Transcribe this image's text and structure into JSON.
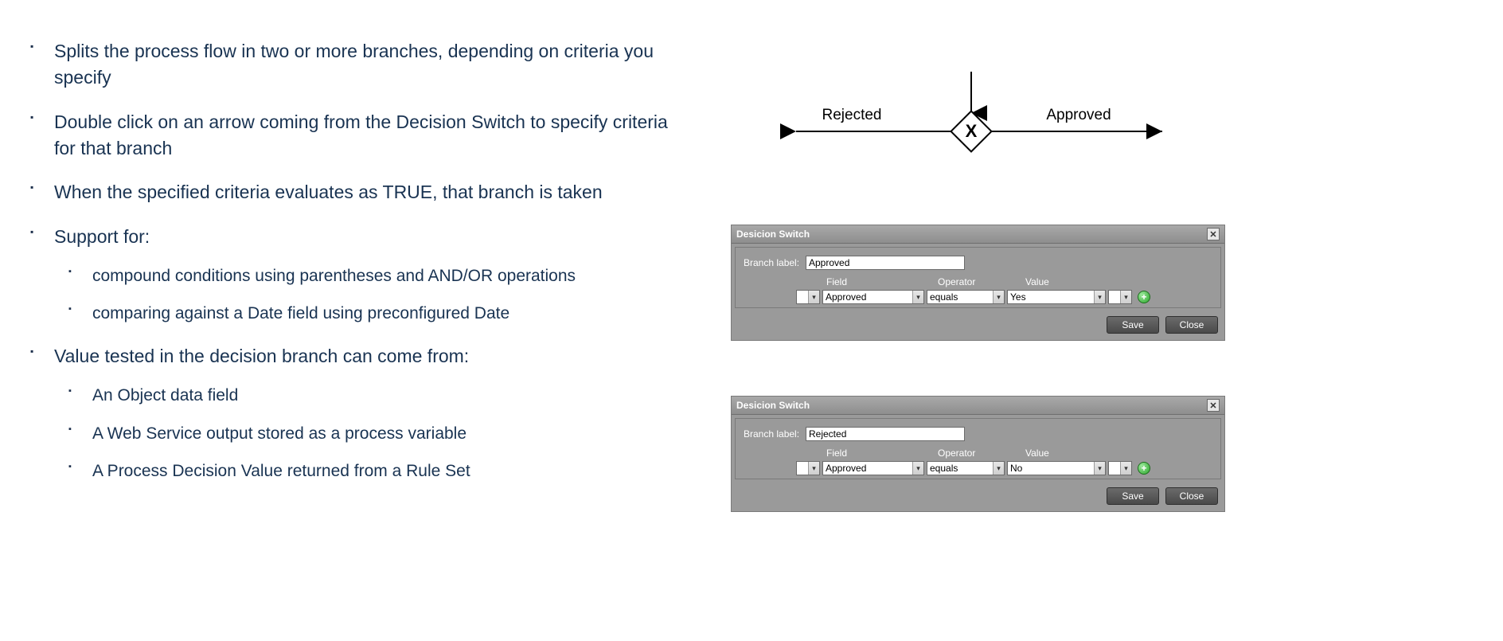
{
  "bullets": {
    "b1": "Splits the process flow in two or more branches, depending on criteria you specify",
    "b2": "Double click on an arrow coming from the Decision Switch to specify criteria for that branch",
    "b3": "When the specified criteria evaluates as TRUE, that branch is taken",
    "b4": "Support for:",
    "b4_sub": {
      "s1": "compound conditions using parentheses and AND/OR operations",
      "s2": "comparing against a Date field using preconfigured Date"
    },
    "b5": "Value tested in the decision branch can come from:",
    "b5_sub": {
      "s1": "An Object data field",
      "s2": "A Web Service output stored as a process variable",
      "s3": "A Process Decision Value returned from a Rule Set"
    }
  },
  "diagram": {
    "left_label": "Rejected",
    "right_label": "Approved",
    "gateway_letter": "X"
  },
  "dialog_common": {
    "title": "Desicion Switch",
    "branch_label_caption": "Branch label:",
    "col_field": "Field",
    "col_operator": "Operator",
    "col_value": "Value",
    "save": "Save",
    "close": "Close"
  },
  "dialog1": {
    "branch_value": "Approved",
    "field": "Approved",
    "operator": "equals",
    "value": "Yes"
  },
  "dialog2": {
    "branch_value": "Rejected",
    "field": "Approved",
    "operator": "equals",
    "value": "No"
  }
}
